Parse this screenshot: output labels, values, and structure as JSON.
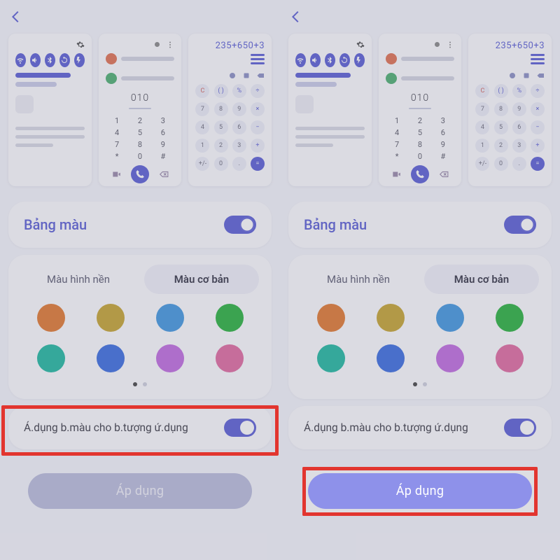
{
  "sectionTitle": "Bảng màu",
  "tabs": {
    "wallpaper": "Màu hình nền",
    "basic": "Màu cơ bản"
  },
  "applyIconsLabel": "Á.dụng b.màu cho b.tượng ứ.dụng",
  "applyButtonLabel": "Áp dụng",
  "previews": {
    "phone": {
      "number": "010",
      "keys": [
        "1",
        "2",
        "3",
        "4",
        "5",
        "6",
        "7",
        "8",
        "9",
        "*",
        "0",
        "#"
      ]
    },
    "calc": {
      "expression": "235+650+3",
      "keys": [
        {
          "t": "C",
          "cls": "c"
        },
        {
          "t": "( )",
          "cls": "op"
        },
        {
          "t": "%",
          "cls": "op"
        },
        {
          "t": "÷",
          "cls": "op"
        },
        {
          "t": "7"
        },
        {
          "t": "8"
        },
        {
          "t": "9"
        },
        {
          "t": "×",
          "cls": "op"
        },
        {
          "t": "4"
        },
        {
          "t": "5"
        },
        {
          "t": "6"
        },
        {
          "t": "−",
          "cls": "op"
        },
        {
          "t": "1"
        },
        {
          "t": "2"
        },
        {
          "t": "3"
        },
        {
          "t": "+",
          "cls": "op"
        },
        {
          "t": "+/-"
        },
        {
          "t": "0"
        },
        {
          "t": "."
        },
        {
          "t": "=",
          "cls": "eq"
        }
      ]
    }
  },
  "palette": [
    "c0",
    "c1",
    "c2",
    "c3",
    "c4",
    "c5",
    "c6",
    "c7"
  ],
  "left": {
    "highlight": "apply-icons"
  },
  "right": {
    "highlight": "apply-button",
    "applyButtonBright": true
  }
}
